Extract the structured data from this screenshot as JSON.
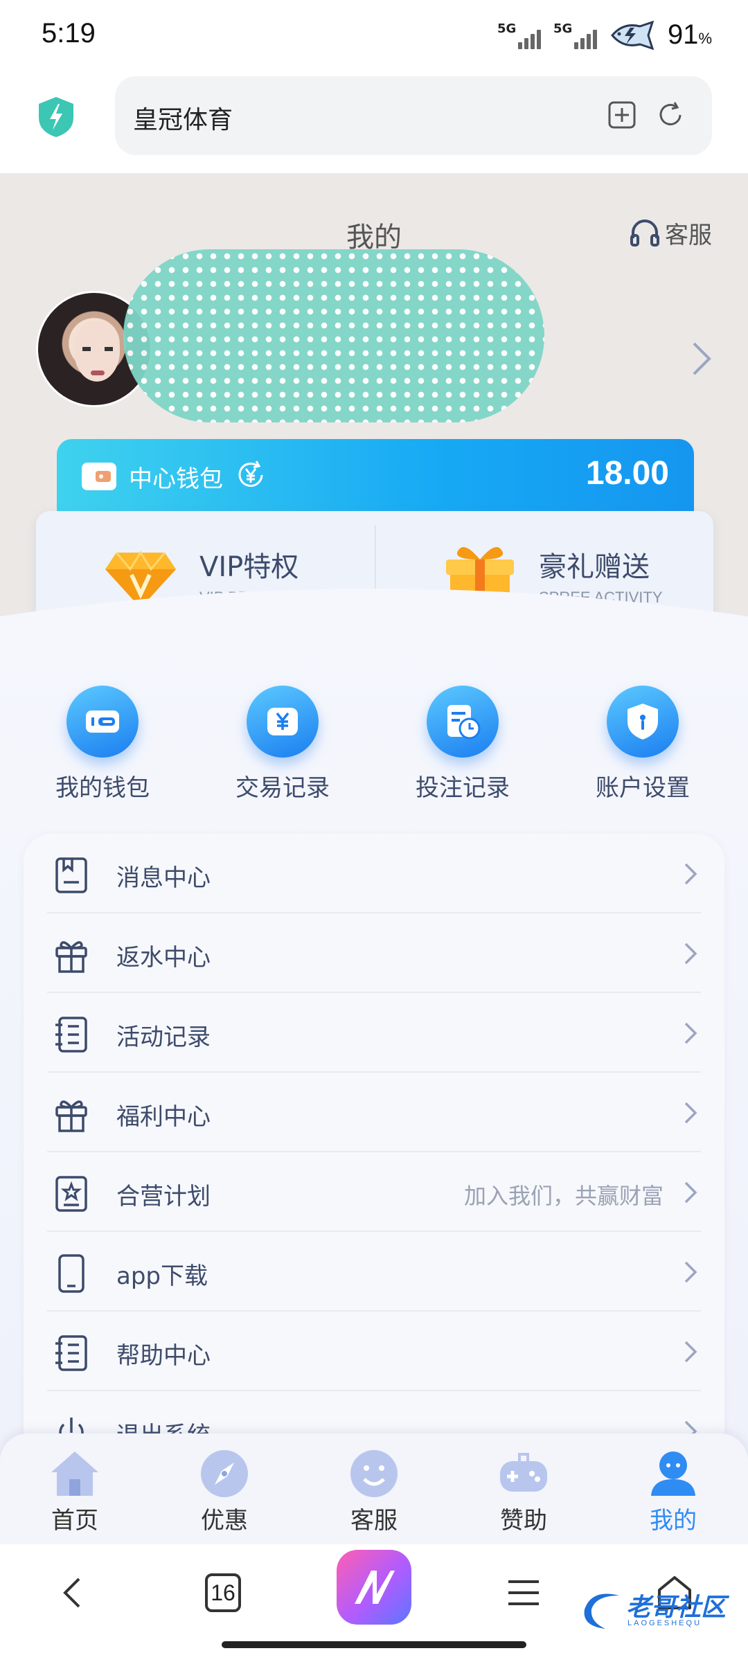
{
  "status_bar": {
    "time": "5:19",
    "net1": "5G",
    "net2": "5G",
    "battery": "91",
    "battery_unit": "%"
  },
  "browser": {
    "url_text": "皇冠体育"
  },
  "page": {
    "title": "我的",
    "customer_service": "客服"
  },
  "wallet": {
    "label": "中心钱包",
    "amount": "18.00"
  },
  "vip": [
    {
      "title": "VIP特权",
      "subtitle": "VIP PRIVILEGE",
      "icon": "diamond-icon"
    },
    {
      "title": "豪礼赠送",
      "subtitle": "SPREE ACTIVITY",
      "icon": "gift-box-icon"
    }
  ],
  "quick_actions": [
    {
      "label": "我的钱包",
      "icon": "wallet-icon"
    },
    {
      "label": "交易记录",
      "icon": "yuan-icon"
    },
    {
      "label": "投注记录",
      "icon": "bet-record-icon"
    },
    {
      "label": "账户设置",
      "icon": "shield-icon"
    }
  ],
  "menu": [
    {
      "label": "消息中心",
      "extra": "",
      "icon": "message-icon"
    },
    {
      "label": "返水中心",
      "extra": "",
      "icon": "gift-icon"
    },
    {
      "label": "活动记录",
      "extra": "",
      "icon": "notebook-icon"
    },
    {
      "label": "福利中心",
      "extra": "",
      "icon": "gift-icon"
    },
    {
      "label": "合营计划",
      "extra": "加入我们，共赢财富",
      "icon": "star-book-icon"
    },
    {
      "label": "app下载",
      "extra": "",
      "icon": "phone-icon"
    },
    {
      "label": "帮助中心",
      "extra": "",
      "icon": "notebook-icon"
    },
    {
      "label": "退出系统",
      "extra": "",
      "icon": "power-icon"
    }
  ],
  "tabs": [
    {
      "label": "首页",
      "icon": "home-icon",
      "active": false
    },
    {
      "label": "优惠",
      "icon": "compass-icon",
      "active": false
    },
    {
      "label": "客服",
      "icon": "smiley-icon",
      "active": false
    },
    {
      "label": "赞助",
      "icon": "gamepad-icon",
      "active": false
    },
    {
      "label": "我的",
      "icon": "user-icon",
      "active": true
    }
  ],
  "browser_nav": {
    "tab_count": "16",
    "watermark": "老哥社区",
    "watermark_sub": "LAOGESHEQU"
  },
  "colors": {
    "accent": "#2f8cf2",
    "wallet_gradient_start": "#3fd2ee",
    "wallet_gradient_end": "#1596f0",
    "redaction": "#7fd6c7"
  }
}
